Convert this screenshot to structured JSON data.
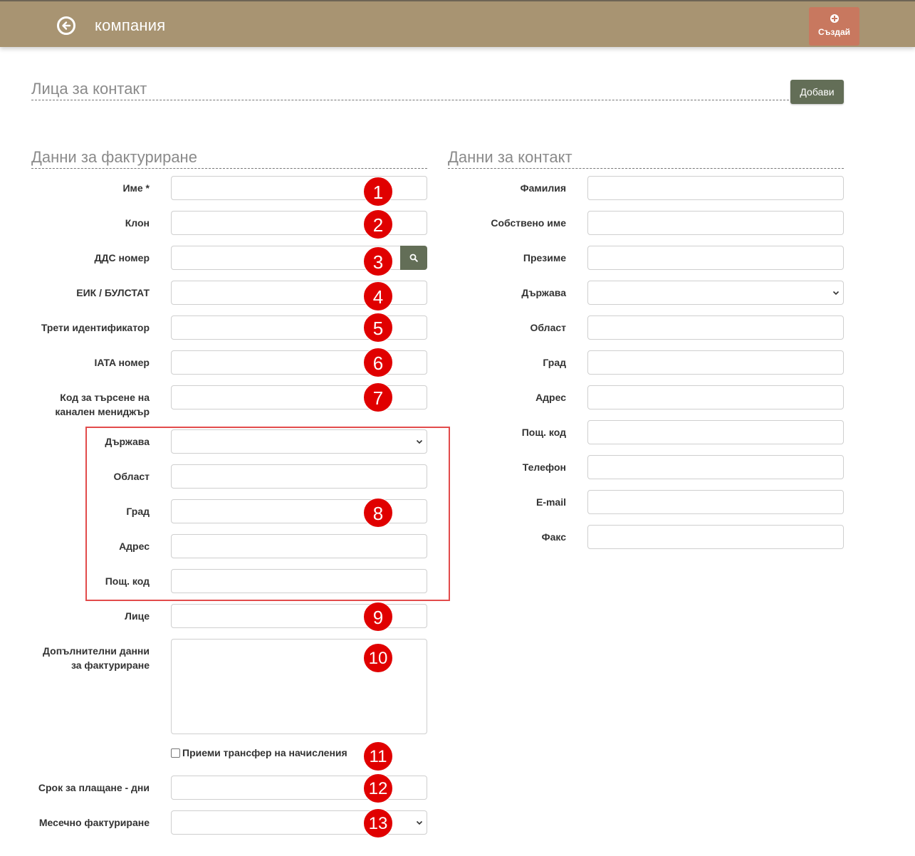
{
  "header": {
    "title": "компания",
    "create_label": "Създай"
  },
  "contacts_section": {
    "title": "Лица за контакт",
    "add_label": "Добави"
  },
  "billing": {
    "title": "Данни за фактуриране",
    "name_label": "Име *",
    "branch_label": "Клон",
    "vat_label": "ДДС номер",
    "eik_label": "ЕИК / БУЛСТАТ",
    "third_id_label": "Трети идентификатор",
    "iata_label": "IATA номер",
    "channel_label_1": "Код за търсене на",
    "channel_label_2": "канален мениджър",
    "country_label": "Държава",
    "region_label": "Област",
    "city_label": "Град",
    "address_label": "Адрес",
    "postcode_label": "Пощ. код",
    "person_label": "Лице",
    "extra_label_1": "Допълнителни данни",
    "extra_label_2": "за фактуриране",
    "transfer_label": "Приеми трансфер на начисления",
    "payment_term_label": "Срок за плащане - дни",
    "monthly_label": "Месечно фактуриране"
  },
  "contact": {
    "title": "Данни за контакт",
    "surname_label": "Фамилия",
    "first_name_label": "Собствено име",
    "middle_name_label": "Презиме",
    "country_label": "Държава",
    "region_label": "Област",
    "city_label": "Град",
    "address_label": "Адрес",
    "postcode_label": "Пощ. код",
    "phone_label": "Телефон",
    "email_label": "E-mail",
    "fax_label": "Факс"
  },
  "badges": [
    "1",
    "2",
    "3",
    "4",
    "5",
    "6",
    "7",
    "8",
    "9",
    "10",
    "11",
    "12",
    "13"
  ],
  "colors": {
    "header_bg": "#a89472",
    "create_btn": "#c8785f",
    "olive_btn": "#636e57",
    "badge": "#e00000",
    "highlight": "#e24b4b"
  },
  "icons": {
    "back": "arrow-left-circle-icon",
    "create": "plus-circle-icon",
    "search": "search-icon"
  }
}
